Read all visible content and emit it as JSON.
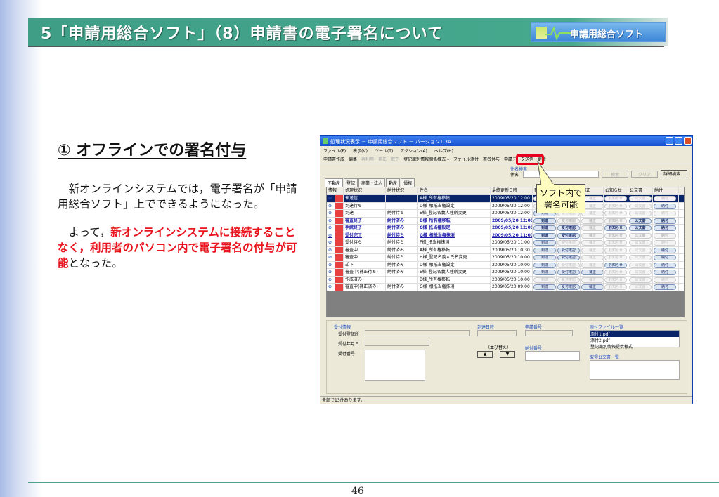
{
  "slide": {
    "title": "5「申請用総合ソフト」（8）申請書の電子署名について",
    "logo_text": "申請用総合ソフト",
    "heading": "① オフラインでの署名付与",
    "para1": "　新オンラインシステムでは，電子署名が「申請用総合ソフト」上でできるようになった。",
    "para2_a": "　よって，",
    "para2_red": "新オンラインシステムに接続することなく，利用者のパソコン内で電子署名の付与が可能",
    "para2_b": "となった。",
    "page_number": "46",
    "callout": "ソフト内で署名可能"
  },
  "app": {
    "title": "処理状況表示 － 申請用総合ソフト － バージョン1.3A",
    "menu": [
      "ファイル(F)",
      "表示(V)",
      "ツール(T)",
      "アクション(A)",
      "ヘルプ(H)"
    ],
    "toolbar": [
      {
        "label": "申請書作成",
        "enabled": true
      },
      {
        "label": "編集",
        "enabled": true
      },
      {
        "label": "再利用",
        "enabled": false
      },
      {
        "label": "補正",
        "enabled": false
      },
      {
        "label": "取下",
        "enabled": false
      },
      {
        "label": "登記識別情報関係様式 ▾",
        "enabled": true
      },
      {
        "label": "ファイル添付",
        "enabled": true
      },
      {
        "label": "署名付与",
        "enabled": true
      },
      {
        "label": "申請データ送信",
        "enabled": true
      },
      {
        "label": "更新",
        "enabled": true
      }
    ],
    "search": {
      "group": "件名検索",
      "label": "件名",
      "value": "",
      "search_btn": "検索",
      "clear_btn": "クリア",
      "detail_btn": "詳細検索..."
    },
    "tabs": [
      "不動産",
      "登記",
      "商業・法人",
      "動産",
      "債権"
    ],
    "columns": [
      "情報",
      "処理状況",
      "納付状況",
      "件名",
      "最終更新日時",
      "到達",
      "受付確認",
      "補正",
      "お知らせ",
      "公文書",
      "納付"
    ],
    "button_labels": [
      "到達",
      "受付確認",
      "補正",
      "お知らせ",
      "公文書",
      "納付"
    ],
    "rows": [
      {
        "status": "未送信",
        "pay": "",
        "subject": "A様_所有権移転",
        "date": "2009/05/20 12:00",
        "btns": [
          0,
          0,
          0,
          0,
          0,
          0
        ],
        "style": "sel"
      },
      {
        "status": "到達待ち",
        "pay": "",
        "subject": "D様_根抵当権設定",
        "date": "2009/05/20 12:00",
        "btns": [
          0,
          0,
          0,
          0,
          0,
          1
        ],
        "style": ""
      },
      {
        "status": "到達",
        "pay": "納付待ち",
        "subject": "E様_登記名義人住所変更",
        "date": "2009/05/20 12:00",
        "btns": [
          1,
          0,
          0,
          0,
          0,
          0
        ],
        "style": ""
      },
      {
        "status": "審査終了",
        "pay": "納付済み",
        "subject": "B様_所有権移転",
        "date": "2009/05/20 12:00",
        "btns": [
          1,
          0,
          0,
          0,
          1,
          1
        ],
        "style": "bold"
      },
      {
        "status": "手続終了",
        "pay": "納付済み",
        "subject": "C様_抵当権設定",
        "date": "2009/05/20 12:00",
        "btns": [
          1,
          1,
          0,
          1,
          1,
          1
        ],
        "style": "bold"
      },
      {
        "status": "受付完了",
        "pay": "納付待ち",
        "subject": "G様_根抵当権抹消",
        "date": "2009/05/20 11:00",
        "btns": [
          1,
          1,
          0,
          0,
          0,
          0
        ],
        "style": "bold"
      },
      {
        "status": "受付待ち",
        "pay": "納付待ち",
        "subject": "F様_抵当権抹消",
        "date": "2009/05/20 11:00",
        "btns": [
          1,
          0,
          0,
          0,
          0,
          0
        ],
        "style": ""
      },
      {
        "status": "審査中",
        "pay": "納付済み",
        "subject": "A様_所有権移転",
        "date": "2009/05/20 10:30",
        "btns": [
          1,
          1,
          0,
          0,
          0,
          1
        ],
        "style": ""
      },
      {
        "status": "審査中",
        "pay": "納付待ち",
        "subject": "H様_登記名義人氏名変更",
        "date": "2009/05/20 10:00",
        "btns": [
          1,
          1,
          0,
          0,
          0,
          1
        ],
        "style": ""
      },
      {
        "status": "却下",
        "pay": "納付済み",
        "subject": "D様_根抵当権設定",
        "date": "2009/05/20 10:00",
        "btns": [
          1,
          0,
          0,
          1,
          0,
          1
        ],
        "style": ""
      },
      {
        "status": "審査中(補正待ち)",
        "pay": "納付済み",
        "subject": "E様_登記名義人住所変更",
        "date": "2009/05/20 10:00",
        "btns": [
          1,
          1,
          1,
          0,
          0,
          1
        ],
        "style": ""
      },
      {
        "status": "作成済み",
        "pay": "",
        "subject": "B様_所有権移転",
        "date": "2009/05/20 10:00",
        "btns": [
          0,
          0,
          0,
          0,
          0,
          0
        ],
        "style": ""
      },
      {
        "status": "審査中(補正済み)",
        "pay": "納付済み",
        "subject": "G様_根抵当権抹消",
        "date": "2009/05/20 09:00",
        "btns": [
          1,
          1,
          1,
          0,
          0,
          1
        ],
        "style": ""
      }
    ],
    "detail": {
      "group": "受付情報",
      "office": "受付登記所",
      "date": "受付年月日",
      "number": "受付番号",
      "arrival": "到達日時",
      "sort": "（並び替え）",
      "up": "▲",
      "down": "▼",
      "app_no": "申請番号",
      "pay_no": "納付番号",
      "attach_title": "添付ファイル一覧",
      "attachments": [
        "添付1.pdf",
        "添付2.pdf",
        "登記識別情報提供様式"
      ],
      "docs_title": "取得公文書一覧"
    },
    "status_bar": "全部で13件あります。"
  }
}
